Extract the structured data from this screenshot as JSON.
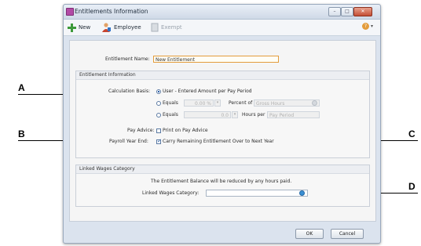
{
  "callouts": {
    "a": "A",
    "b": "B",
    "c": "C",
    "d": "D"
  },
  "window": {
    "title": "Entitlements Information",
    "controls": {
      "minimize": "–",
      "maximize": "□",
      "close": "✕"
    }
  },
  "toolbar": {
    "new_label": "New",
    "employee_label": "Employee",
    "exempt_label": "Exempt"
  },
  "form": {
    "entitlement_name_label": "Entitlement Name:",
    "entitlement_name_value": "New Entitlement"
  },
  "entitlement_info": {
    "title": "Entitlement Information",
    "calculation_basis_label": "Calculation Basis:",
    "option_user": "User - Entered Amount per Pay Period",
    "option_equals_1": "Equals",
    "percent_value": "0.00 %",
    "percent_of_label": "Percent of",
    "gross_hours_value": "Gross Hours",
    "option_equals_2": "Equals",
    "hours_value": "0.0",
    "hours_per_label": "Hours per",
    "pay_period_value": "Pay Period",
    "pay_advice_label": "Pay Advice:",
    "print_on_pay_advice": "Print on Pay Advice",
    "payroll_year_end_label": "Payroll Year End:",
    "carry_remaining": "Carry Remaining Entitlement Over to Next Year"
  },
  "linked": {
    "title": "Linked Wages Category",
    "note": "The Entitlement Balance will be reduced by any hours paid.",
    "category_label": "Linked Wages Category:",
    "category_value": ""
  },
  "buttons": {
    "ok": "OK",
    "cancel": "Cancel"
  },
  "icons": {
    "new": "plus-icon",
    "employee": "employee-icon",
    "exempt": "exempt-icon",
    "help": "help-icon",
    "search": "search-icon",
    "dropdown": "chevron-down-icon"
  },
  "colors": {
    "accent": "#2f61a8",
    "name_field_border": "#e39c3c",
    "help": "#3a8fd3"
  }
}
